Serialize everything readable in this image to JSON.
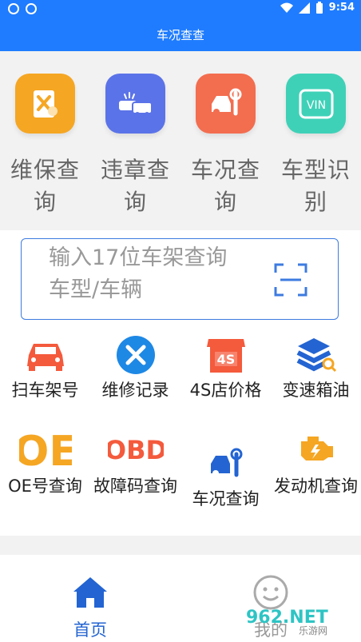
{
  "status_bar": {
    "time": "9:54"
  },
  "header": {
    "title": "车况查查"
  },
  "top_features": [
    {
      "label": "维保查询",
      "icon": "repair-doc-icon",
      "color": "#f5a623"
    },
    {
      "label": "违章查询",
      "icon": "cars-crash-icon",
      "color": "#5b73e8"
    },
    {
      "label": "车况查询",
      "icon": "car-wrench-icon",
      "color": "#f36d4f"
    },
    {
      "label": "车型识别",
      "icon": "vin-icon",
      "color": "#3fd1b8"
    }
  ],
  "search": {
    "placeholder": "输入17位车架查询车型/车辆"
  },
  "grid_items": [
    {
      "label": "扫车架号",
      "icon": "car-icon"
    },
    {
      "label": "维修记录",
      "icon": "tools-icon"
    },
    {
      "label": "4S店价格",
      "icon": "store-4s-icon",
      "badge": "4S"
    },
    {
      "label": "变速箱油",
      "icon": "layers-search-icon"
    },
    {
      "label": "OE号查询",
      "icon": "oe-icon",
      "badge": "OE"
    },
    {
      "label": "故障码查询",
      "icon": "obd-icon",
      "badge": "OBD"
    },
    {
      "label": "车况查询",
      "icon": "car-wrench-blue-icon"
    },
    {
      "label": "发动机查询",
      "icon": "engine-icon"
    }
  ],
  "bottom_nav": [
    {
      "label": "首页",
      "icon": "home-icon",
      "active": true
    },
    {
      "label": "我的",
      "icon": "smile-icon",
      "active": false
    }
  ],
  "watermark": {
    "text": "962.NET",
    "sub": "乐游网"
  }
}
